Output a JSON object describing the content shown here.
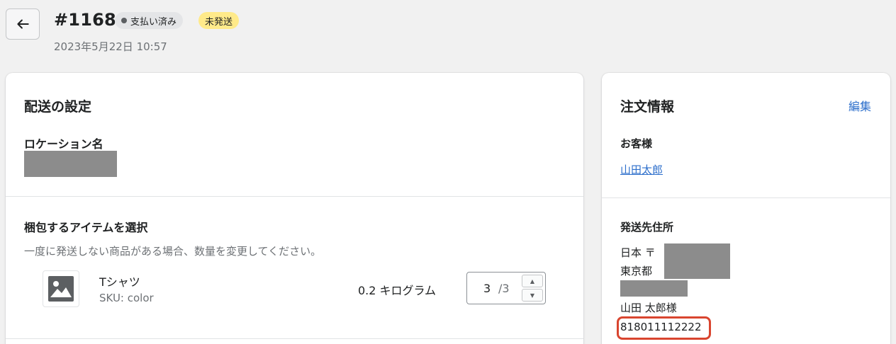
{
  "header": {
    "order_number": "#1168",
    "payment_status": "支払い済み",
    "fulfillment_status": "未発送",
    "date": "2023年5月22日 10:57",
    "back_icon": "arrow-left-icon"
  },
  "shipping_card": {
    "title": "配送の設定",
    "location_label": "ロケーション名",
    "items_label": "梱包するアイテムを選択",
    "hint": "一度に発送しない商品がある場合、数量を変更してください。",
    "item": {
      "name": "Tシャツ",
      "sku": "SKU: color",
      "weight": "0.2 キログラム",
      "quantity": "3",
      "quantity_total": "/3",
      "image_icon": "image-placeholder-icon"
    }
  },
  "order_info_card": {
    "title": "注文情報",
    "edit_label": "編集",
    "customer_label": "お客様",
    "customer_name": "山田太郎",
    "address_label": "発送先住所",
    "address": {
      "country_postal": "日本 〒",
      "prefecture": "東京都",
      "recipient": "山田 太郎様",
      "phone": "818011112222"
    }
  },
  "colors": {
    "accent_link": "#2c6ecb",
    "badge_unfulfilled": "#ffea8a",
    "badge_paid": "#e4e5e7",
    "highlight": "#d9452f"
  }
}
